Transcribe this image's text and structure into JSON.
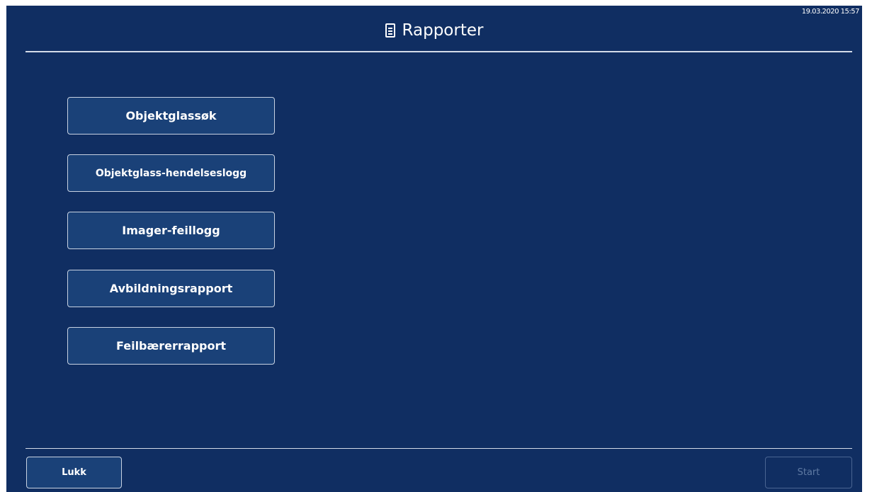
{
  "header": {
    "title": "Rapporter",
    "icon": "report-document-icon",
    "timestamp": "19.03.2020 15:57"
  },
  "menu": {
    "items": [
      {
        "label": "Objektglassøk"
      },
      {
        "label": "Objektglass-hendelseslogg"
      },
      {
        "label": "Imager-feillogg"
      },
      {
        "label": "Avbildningsrapport"
      },
      {
        "label": "Feilbærerrapport"
      }
    ]
  },
  "footer": {
    "close_label": "Lukk",
    "start_label": "Start",
    "start_disabled": true
  },
  "colors": {
    "background": "#102e62",
    "button_fill": "#1a4178",
    "button_border": "#c8d2e2",
    "disabled_text": "#5f7aa3"
  }
}
